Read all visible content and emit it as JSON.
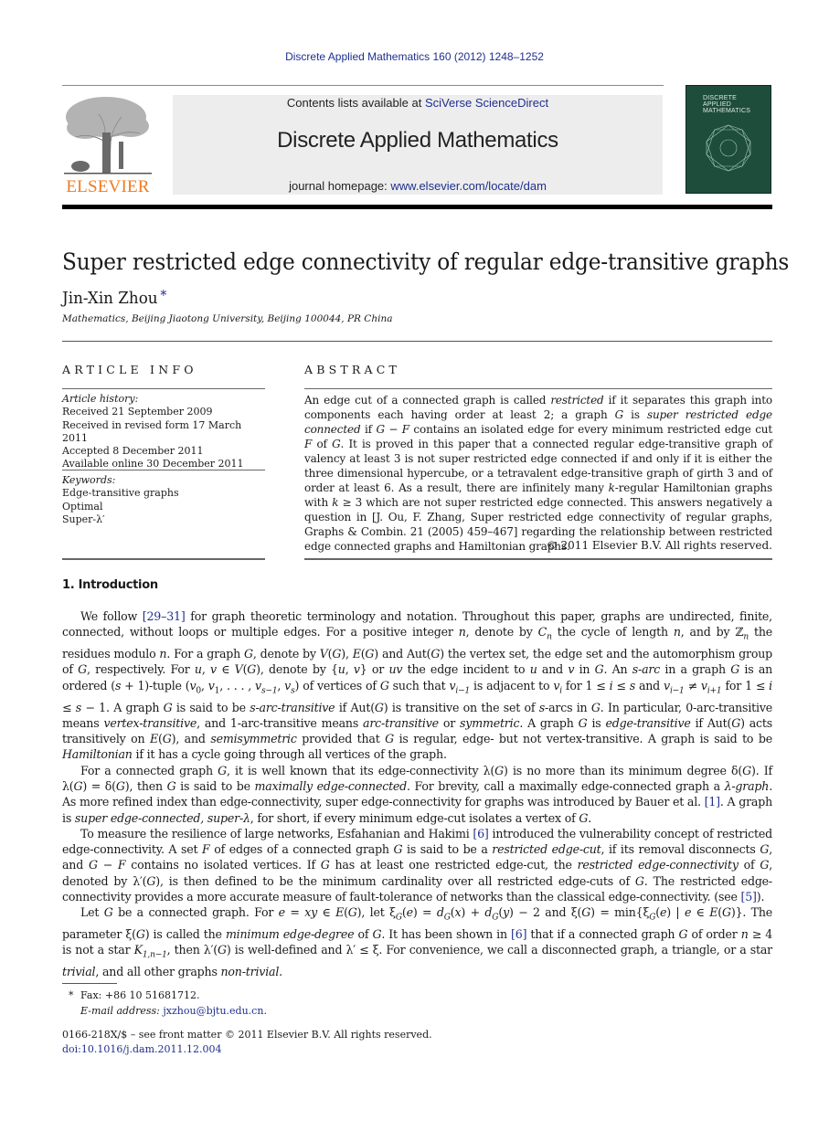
{
  "header": {
    "journal_reference": "Discrete Applied Mathematics 160 (2012) 1248–1252",
    "contents_prefix": "Contents lists available at ",
    "contents_link": "SciVerse ScienceDirect",
    "journal_name": "Discrete Applied Mathematics",
    "homepage_prefix": "journal homepage: ",
    "homepage_link": "www.elsevier.com/locate/dam",
    "publisher_logo_text": "ELSEVIER",
    "cover": {
      "title_lines": [
        "DISCRETE",
        "APPLIED",
        "MATHEMATICS"
      ],
      "color": "#1f4d3b"
    },
    "logo_color": "#f07a1e",
    "link_color": "#1f2f8f"
  },
  "paper": {
    "title": "Super restricted edge connectivity of regular edge-transitive graphs",
    "author": "Jin-Xin Zhou",
    "author_marker": "*",
    "affiliation": "Mathematics, Beijing Jiaotong University, Beijing 100044, PR China"
  },
  "article_info": {
    "heading": "ARTICLE INFO",
    "history_label": "Article history:",
    "history": [
      "Received 21 September 2009",
      "Received in revised form 17 March 2011",
      "Accepted 8 December 2011",
      "Available online 30 December 2011"
    ],
    "keywords_label": "Keywords:",
    "keywords": [
      "Edge-transitive graphs",
      "Optimal",
      "Super-λ′"
    ]
  },
  "abstract": {
    "heading": "ABSTRACT",
    "segments": [
      {
        "t": "An edge cut of a connected graph is called "
      },
      {
        "t": "restricted",
        "i": true
      },
      {
        "t": " if it separates this graph into components each having order at least 2; a graph "
      },
      {
        "t": "G",
        "i": true
      },
      {
        "t": " is "
      },
      {
        "t": "super restricted edge connected",
        "i": true
      },
      {
        "t": " if "
      },
      {
        "t": "G",
        "i": true
      },
      {
        "t": " − "
      },
      {
        "t": "F",
        "i": true
      },
      {
        "t": " contains an isolated edge for every minimum restricted edge cut "
      },
      {
        "t": "F",
        "i": true
      },
      {
        "t": " of "
      },
      {
        "t": "G",
        "i": true
      },
      {
        "t": ". It is proved in this paper that a connected regular edge-transitive graph of valency at least 3 is not super restricted edge connected if and only if it is either the three dimensional hypercube, or a tetravalent edge-transitive graph of girth 3 and of order at least 6. As a result, there are infinitely many "
      },
      {
        "t": "k",
        "i": true
      },
      {
        "t": "-regular Hamiltonian graphs with "
      },
      {
        "t": "k",
        "i": true
      },
      {
        "t": " ≥ 3 which are not super restricted edge connected. This answers negatively a question in [J. Ou, F. Zhang, Super restricted edge connectivity of regular graphs, Graphs & Combin. 21 (2005) 459–467] regarding the relationship between restricted edge connected graphs and Hamiltonian graphs."
      }
    ],
    "copyright": "© 2011 Elsevier B.V. All rights reserved."
  },
  "introduction": {
    "heading": "1.  Introduction",
    "paragraphs": [
      [
        {
          "t": "We follow "
        },
        {
          "t": "[29–31]",
          "link": true
        },
        {
          "t": " for graph theoretic terminology and notation. Throughout this paper, graphs are undirected, finite, connected, without loops or multiple edges. For a positive integer "
        },
        {
          "t": "n",
          "i": true
        },
        {
          "t": ", denote by "
        },
        {
          "t": "C",
          "i": true
        },
        {
          "t": "n",
          "i": true,
          "sub": true
        },
        {
          "t": " the cycle of length "
        },
        {
          "t": "n",
          "i": true
        },
        {
          "t": ", and by ℤ"
        },
        {
          "t": "n",
          "i": true,
          "sub": true
        },
        {
          "t": " the residues modulo "
        },
        {
          "t": "n",
          "i": true
        },
        {
          "t": ". For a graph "
        },
        {
          "t": "G",
          "i": true
        },
        {
          "t": ", denote by "
        },
        {
          "t": "V",
          "i": true
        },
        {
          "t": "("
        },
        {
          "t": "G",
          "i": true
        },
        {
          "t": "), "
        },
        {
          "t": "E",
          "i": true
        },
        {
          "t": "("
        },
        {
          "t": "G",
          "i": true
        },
        {
          "t": ") and Aut("
        },
        {
          "t": "G",
          "i": true
        },
        {
          "t": ") the vertex set, the edge set and the automorphism group of "
        },
        {
          "t": "G",
          "i": true
        },
        {
          "t": ", respectively. For "
        },
        {
          "t": "u",
          "i": true
        },
        {
          "t": ", "
        },
        {
          "t": "v",
          "i": true
        },
        {
          "t": " ∈ "
        },
        {
          "t": "V",
          "i": true
        },
        {
          "t": "("
        },
        {
          "t": "G",
          "i": true
        },
        {
          "t": "), denote by {"
        },
        {
          "t": "u",
          "i": true
        },
        {
          "t": ", "
        },
        {
          "t": "v",
          "i": true
        },
        {
          "t": "} or "
        },
        {
          "t": "uv",
          "i": true
        },
        {
          "t": " the edge incident to "
        },
        {
          "t": "u",
          "i": true
        },
        {
          "t": " and "
        },
        {
          "t": "v",
          "i": true
        },
        {
          "t": " in "
        },
        {
          "t": "G",
          "i": true
        },
        {
          "t": ". An "
        },
        {
          "t": "s-arc",
          "i": true
        },
        {
          "t": " in a graph "
        },
        {
          "t": "G",
          "i": true
        },
        {
          "t": " is an ordered ("
        },
        {
          "t": "s",
          "i": true
        },
        {
          "t": " + 1)-tuple ("
        },
        {
          "t": "v",
          "i": true
        },
        {
          "t": "0",
          "sub": true
        },
        {
          "t": ", "
        },
        {
          "t": "v",
          "i": true
        },
        {
          "t": "1",
          "sub": true
        },
        {
          "t": ", . . . , "
        },
        {
          "t": "v",
          "i": true
        },
        {
          "t": "s−1",
          "i": true,
          "sub": true
        },
        {
          "t": ", "
        },
        {
          "t": "v",
          "i": true
        },
        {
          "t": "s",
          "i": true,
          "sub": true
        },
        {
          "t": ") of vertices of "
        },
        {
          "t": "G",
          "i": true
        },
        {
          "t": " such that "
        },
        {
          "t": "v",
          "i": true
        },
        {
          "t": "i−1",
          "i": true,
          "sub": true
        },
        {
          "t": " is adjacent to "
        },
        {
          "t": "v",
          "i": true
        },
        {
          "t": "i",
          "i": true,
          "sub": true
        },
        {
          "t": " for 1 ≤ "
        },
        {
          "t": "i",
          "i": true
        },
        {
          "t": " ≤ "
        },
        {
          "t": "s",
          "i": true
        },
        {
          "t": " and "
        },
        {
          "t": "v",
          "i": true
        },
        {
          "t": "i−1",
          "i": true,
          "sub": true
        },
        {
          "t": " ≠ "
        },
        {
          "t": "v",
          "i": true
        },
        {
          "t": "i+1",
          "i": true,
          "sub": true
        },
        {
          "t": " for 1 ≤ "
        },
        {
          "t": "i",
          "i": true
        },
        {
          "t": " ≤ "
        },
        {
          "t": "s",
          "i": true
        },
        {
          "t": " − 1. A graph "
        },
        {
          "t": "G",
          "i": true
        },
        {
          "t": " is said to be "
        },
        {
          "t": "s-arc-transitive",
          "i": true
        },
        {
          "t": " if Aut("
        },
        {
          "t": "G",
          "i": true
        },
        {
          "t": ") is transitive on the set of "
        },
        {
          "t": "s",
          "i": true
        },
        {
          "t": "-arcs in "
        },
        {
          "t": "G",
          "i": true
        },
        {
          "t": ". In particular, 0-arc-transitive means "
        },
        {
          "t": "vertex-transitive",
          "i": true
        },
        {
          "t": ", and 1-arc-transitive means "
        },
        {
          "t": "arc-transitive",
          "i": true
        },
        {
          "t": " or "
        },
        {
          "t": "symmetric",
          "i": true
        },
        {
          "t": ". A graph "
        },
        {
          "t": "G",
          "i": true
        },
        {
          "t": " is "
        },
        {
          "t": "edge-transitive",
          "i": true
        },
        {
          "t": " if Aut("
        },
        {
          "t": "G",
          "i": true
        },
        {
          "t": ") acts transitively on "
        },
        {
          "t": "E",
          "i": true
        },
        {
          "t": "("
        },
        {
          "t": "G",
          "i": true
        },
        {
          "t": "), and "
        },
        {
          "t": "semisymmetric",
          "i": true
        },
        {
          "t": " provided that "
        },
        {
          "t": "G",
          "i": true
        },
        {
          "t": " is regular, edge- but not vertex-transitive. A graph is said to be "
        },
        {
          "t": "Hamiltonian",
          "i": true
        },
        {
          "t": " if it has a cycle going through all vertices of the graph."
        }
      ],
      [
        {
          "t": "For a connected graph "
        },
        {
          "t": "G",
          "i": true
        },
        {
          "t": ", it is well known that its edge-connectivity λ("
        },
        {
          "t": "G",
          "i": true
        },
        {
          "t": ") is no more than its minimum degree δ("
        },
        {
          "t": "G",
          "i": true
        },
        {
          "t": "). If λ("
        },
        {
          "t": "G",
          "i": true
        },
        {
          "t": ") = δ("
        },
        {
          "t": "G",
          "i": true
        },
        {
          "t": "), then "
        },
        {
          "t": "G",
          "i": true
        },
        {
          "t": " is said to be "
        },
        {
          "t": "maximally edge-connected",
          "i": true
        },
        {
          "t": ". For brevity, call a maximally edge-connected graph a "
        },
        {
          "t": "λ-graph",
          "i": true
        },
        {
          "t": ". As more refined index than edge-connectivity, super edge-connectivity for graphs was introduced by Bauer et al. "
        },
        {
          "t": "[1]",
          "link": true
        },
        {
          "t": ". A graph is "
        },
        {
          "t": "super edge-connected, super-λ",
          "i": true
        },
        {
          "t": ", for short, if every minimum edge-cut isolates a vertex of "
        },
        {
          "t": "G",
          "i": true
        },
        {
          "t": "."
        }
      ],
      [
        {
          "t": "To measure the resilience of large networks, Esfahanian and Hakimi "
        },
        {
          "t": "[6]",
          "link": true
        },
        {
          "t": " introduced the vulnerability concept of restricted edge-connectivity. A set "
        },
        {
          "t": "F",
          "i": true
        },
        {
          "t": " of edges of a connected graph "
        },
        {
          "t": "G",
          "i": true
        },
        {
          "t": " is said to be a "
        },
        {
          "t": "restricted edge-cut",
          "i": true
        },
        {
          "t": ", if its removal disconnects "
        },
        {
          "t": "G",
          "i": true
        },
        {
          "t": ", and "
        },
        {
          "t": "G",
          "i": true
        },
        {
          "t": " − "
        },
        {
          "t": "F",
          "i": true
        },
        {
          "t": " contains no isolated vertices. If "
        },
        {
          "t": "G",
          "i": true
        },
        {
          "t": " has at least one restricted edge-cut, the "
        },
        {
          "t": "restricted edge-connectivity",
          "i": true
        },
        {
          "t": " of "
        },
        {
          "t": "G",
          "i": true
        },
        {
          "t": ", denoted by λ′("
        },
        {
          "t": "G",
          "i": true
        },
        {
          "t": "), is then defined to be the minimum cardinality over all restricted edge-cuts of "
        },
        {
          "t": "G",
          "i": true
        },
        {
          "t": ". The restricted edge-connectivity provides a more accurate measure of fault-tolerance of networks than the classical edge-connectivity. (see "
        },
        {
          "t": "[5]",
          "link": true
        },
        {
          "t": ")."
        }
      ],
      [
        {
          "t": "Let "
        },
        {
          "t": "G",
          "i": true
        },
        {
          "t": " be a connected graph. For "
        },
        {
          "t": "e",
          "i": true
        },
        {
          "t": " = "
        },
        {
          "t": "xy",
          "i": true
        },
        {
          "t": " ∈ "
        },
        {
          "t": "E",
          "i": true
        },
        {
          "t": "("
        },
        {
          "t": "G",
          "i": true
        },
        {
          "t": "), let ξ"
        },
        {
          "t": "G",
          "i": true,
          "sub": true
        },
        {
          "t": "("
        },
        {
          "t": "e",
          "i": true
        },
        {
          "t": ") = "
        },
        {
          "t": "d",
          "i": true
        },
        {
          "t": "G",
          "i": true,
          "sub": true
        },
        {
          "t": "("
        },
        {
          "t": "x",
          "i": true
        },
        {
          "t": ") + "
        },
        {
          "t": "d",
          "i": true
        },
        {
          "t": "G",
          "i": true,
          "sub": true
        },
        {
          "t": "("
        },
        {
          "t": "y",
          "i": true
        },
        {
          "t": ") − 2 and ξ("
        },
        {
          "t": "G",
          "i": true
        },
        {
          "t": ") = min{ξ"
        },
        {
          "t": "G",
          "i": true,
          "sub": true
        },
        {
          "t": "("
        },
        {
          "t": "e",
          "i": true
        },
        {
          "t": ") | "
        },
        {
          "t": "e",
          "i": true
        },
        {
          "t": " ∈ "
        },
        {
          "t": "E",
          "i": true
        },
        {
          "t": "("
        },
        {
          "t": "G",
          "i": true
        },
        {
          "t": ")}. The parameter ξ("
        },
        {
          "t": "G",
          "i": true
        },
        {
          "t": ") is called the "
        },
        {
          "t": "minimum edge-degree",
          "i": true
        },
        {
          "t": " of "
        },
        {
          "t": "G",
          "i": true
        },
        {
          "t": ". It has been shown in "
        },
        {
          "t": "[6]",
          "link": true
        },
        {
          "t": " that if a connected graph "
        },
        {
          "t": "G",
          "i": true
        },
        {
          "t": " of order "
        },
        {
          "t": "n",
          "i": true
        },
        {
          "t": " ≥ 4 is not a star "
        },
        {
          "t": "K",
          "i": true
        },
        {
          "t": "1,n−1",
          "i": true,
          "sub": true
        },
        {
          "t": ", then λ′("
        },
        {
          "t": "G",
          "i": true
        },
        {
          "t": ") is well-defined and λ′ ≤ ξ. For convenience, we call a disconnected graph, a triangle, or a star "
        },
        {
          "t": "trivial",
          "i": true
        },
        {
          "t": ", and all other graphs "
        },
        {
          "t": "non-trivial",
          "i": true
        },
        {
          "t": "."
        }
      ]
    ]
  },
  "footnotes": {
    "marker": "*",
    "fax": "Fax: +86 10 51681712.",
    "email_label": "E-mail address:",
    "email": "jxzhou@bjtu.edu.cn",
    "issn_line": "0166-218X/$ – see front matter © 2011 Elsevier B.V. All rights reserved.",
    "doi": "doi:10.1016/j.dam.2011.12.004"
  }
}
